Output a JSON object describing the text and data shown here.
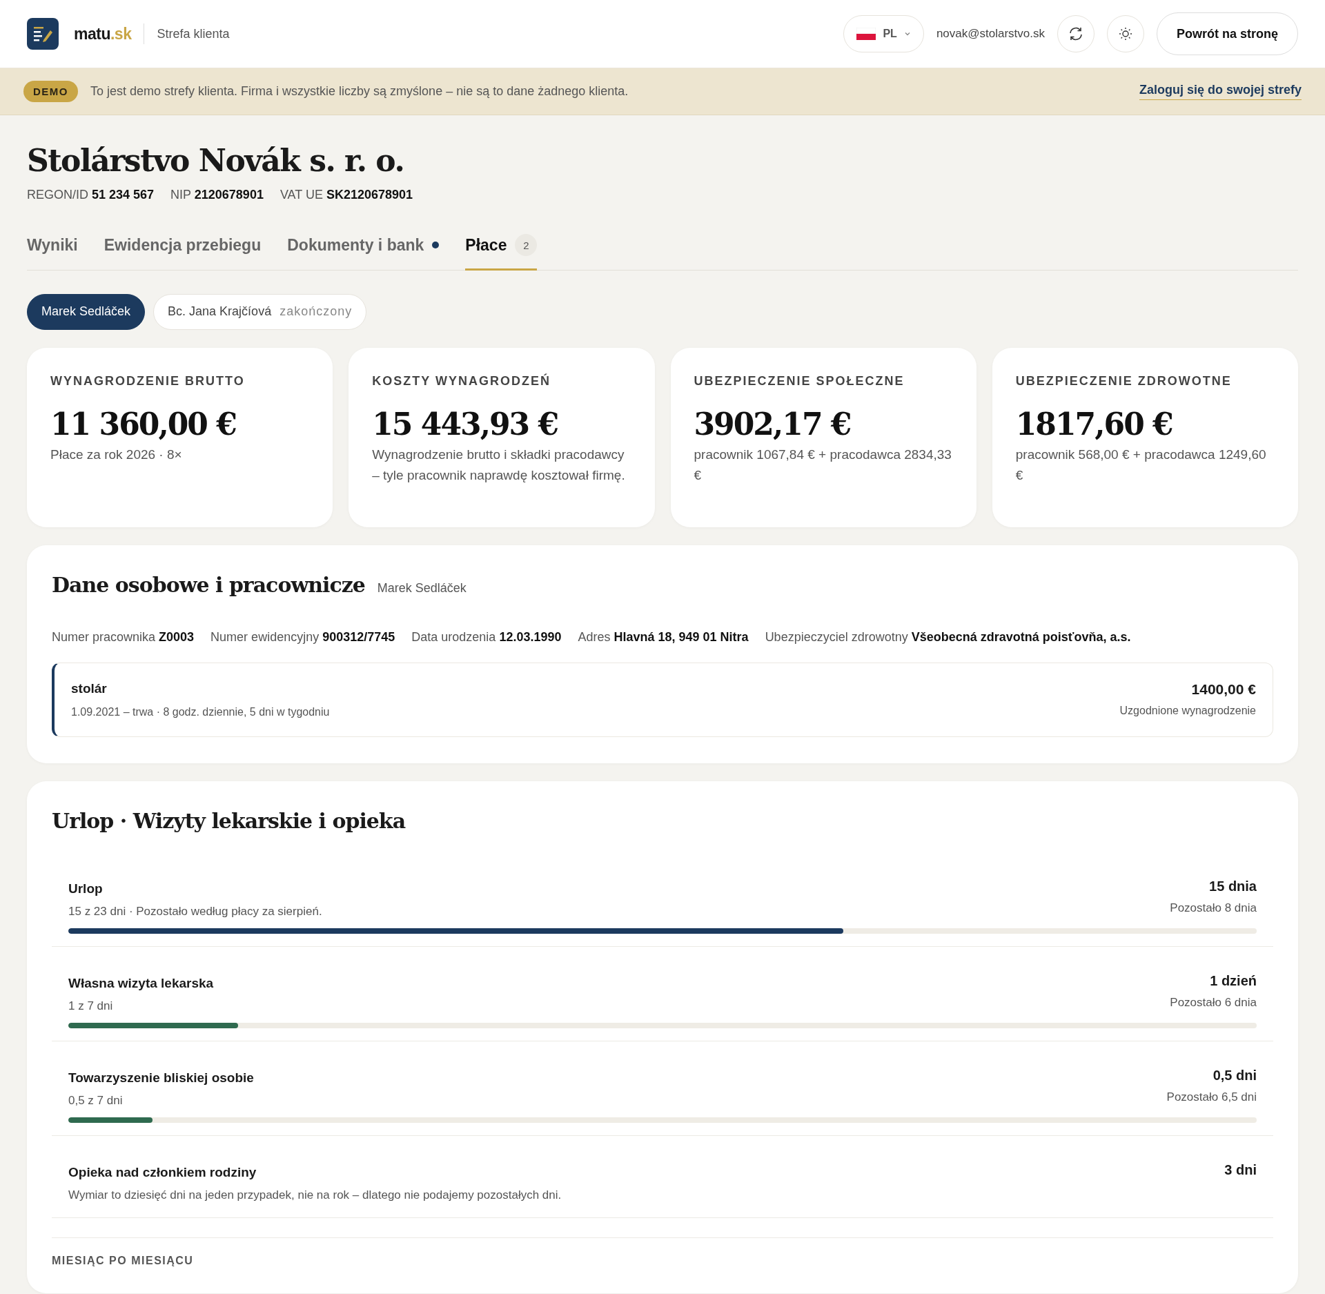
{
  "header": {
    "brand": {
      "name": "matu",
      "suffix": ".sk"
    },
    "section": "Strefa klienta",
    "language": "PL",
    "user_email": "novak@stolarstvo.sk",
    "back_button": "Powrót na stronę"
  },
  "demo_banner": {
    "badge": "DEMO",
    "text": "To jest demo strefy klienta. Firma i wszystkie liczby są zmyślone – nie są to dane żadnego klienta.",
    "link": "Zaloguj się do swojej strefy"
  },
  "company": {
    "name": "Stolárstvo Novák s. r. o.",
    "identifiers": [
      {
        "label": "REGON/ID",
        "value": "51 234 567"
      },
      {
        "label": "NIP",
        "value": "2120678901"
      },
      {
        "label": "VAT UE",
        "value": "SK2120678901"
      }
    ]
  },
  "tabs": [
    {
      "label": "Wyniki",
      "selected": false,
      "dot": false
    },
    {
      "label": "Ewidencja przebiegu",
      "selected": false,
      "dot": false
    },
    {
      "label": "Dokumenty i bank",
      "selected": false,
      "dot": true
    },
    {
      "label": "Płace",
      "selected": true,
      "dot": false,
      "count": "2"
    }
  ],
  "employees": [
    {
      "name": "Marek Sedláček",
      "selected": true
    },
    {
      "name": "Bc. Jana Krajčíová",
      "selected": false,
      "status": "zakończony"
    }
  ],
  "summary_cards": [
    {
      "label": "WYNAGRODZENIE BRUTTO",
      "value": "11 360,00 €",
      "note": "Płace za rok 2026 · 8×"
    },
    {
      "label": "KOSZTY WYNAGRODZEŃ",
      "value": "15 443,93 €",
      "note": "Wynagrodzenie brutto i składki pracodawcy – tyle pracownik naprawdę kosztował firmę."
    },
    {
      "label": "UBEZPIECZENIE SPOŁECZNE",
      "value": "3902,17 €",
      "note": "pracownik 1067,84 € + pracodawca 2834,33 €"
    },
    {
      "label": "UBEZPIECZENIE ZDROWOTNE",
      "value": "1817,60 €",
      "note": "pracownik 568,00 € + pracodawca 1249,60 €"
    }
  ],
  "personal": {
    "title": "Dane osobowe i pracownicze",
    "subtitle": "Marek Sedláček",
    "fields": [
      {
        "label": "Numer pracownika",
        "value": "Z0003"
      },
      {
        "label": "Numer ewidencyjny",
        "value": "900312/7745"
      },
      {
        "label": "Data urodzenia",
        "value": "12.03.1990"
      },
      {
        "label": "Adres",
        "value": "Hlavná 18, 949 01 Nitra"
      },
      {
        "label": "Ubezpieczyciel zdrowotny",
        "value": "Všeobecná zdravotná poisťovňa, a.s."
      }
    ],
    "contract": {
      "position": "stolár",
      "details": "1.09.2021 – trwa · 8 godz. dziennie, 5 dni w tygodniu",
      "amount": "1400,00 €",
      "amount_label": "Uzgodnione wynagrodzenie"
    }
  },
  "leave": {
    "title": "Urlop · Wizyty lekarskie i opieka",
    "items": [
      {
        "kind": "bar",
        "name": "Urlop",
        "detail": "15 z 23 dni · Pozostało według płacy za sierpień.",
        "value": "15 dnia",
        "remaining": "Pozostało 8 dnia",
        "level": 0.652,
        "color": "#1c3a5e"
      },
      {
        "kind": "bar",
        "name": "Własna wizyta lekarska",
        "detail": "1 z 7 dni",
        "value": "1 dzień",
        "remaining": "Pozostało 6 dnia",
        "level": 0.143,
        "color": "#2f6a4f"
      },
      {
        "kind": "bar",
        "name": "Towarzyszenie bliskiej osobie",
        "detail": "0,5 z 7 dni",
        "value": "0,5 dni",
        "remaining": "Pozostało 6,5 dni",
        "level": 0.071,
        "color": "#2f6a4f"
      },
      {
        "kind": "plain",
        "name": "Opieka nad członkiem rodziny",
        "detail": "Wymiar to dziesięć dni na jeden przypadek, nie na rok – dlatego nie podajemy pozostałych dni.",
        "value": "3 dni"
      }
    ],
    "monthly_heading": "MIESIĄC PO MIESIĄCU"
  }
}
